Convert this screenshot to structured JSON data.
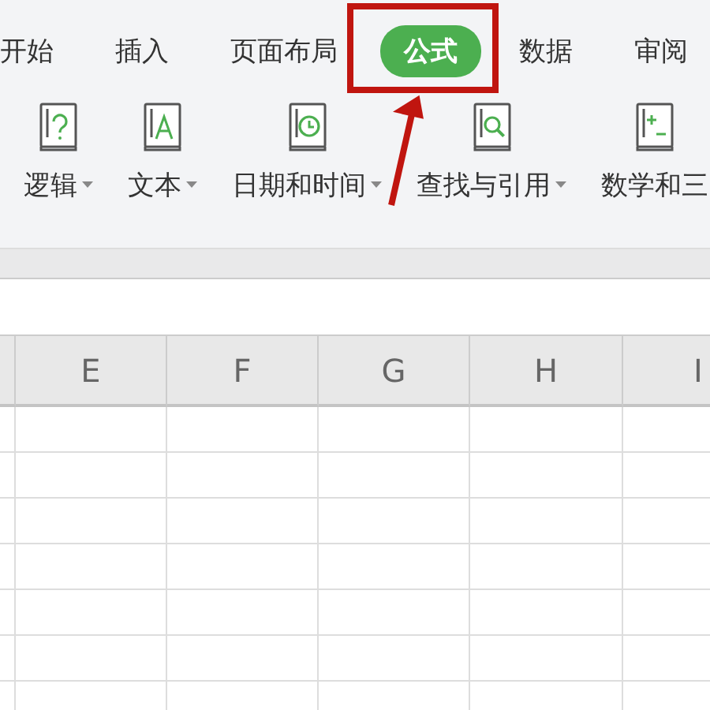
{
  "tabs": [
    {
      "label": "开始",
      "selected": false
    },
    {
      "label": "插入",
      "selected": false
    },
    {
      "label": "页面布局",
      "selected": false
    },
    {
      "label": "公式",
      "selected": true
    },
    {
      "label": "数据",
      "selected": false
    },
    {
      "label": "审阅",
      "selected": false
    }
  ],
  "ribbon": [
    {
      "label": "逻辑",
      "kind": "question",
      "dropdown": true
    },
    {
      "label": "文本",
      "kind": "letter",
      "dropdown": true
    },
    {
      "label": "日期和时间",
      "kind": "clock",
      "dropdown": true
    },
    {
      "label": "查找与引用",
      "kind": "search",
      "dropdown": true
    },
    {
      "label": "数学和三",
      "kind": "math",
      "dropdown": false
    }
  ],
  "sheet": {
    "columns": [
      "",
      "E",
      "F",
      "G",
      "H",
      "I"
    ]
  }
}
